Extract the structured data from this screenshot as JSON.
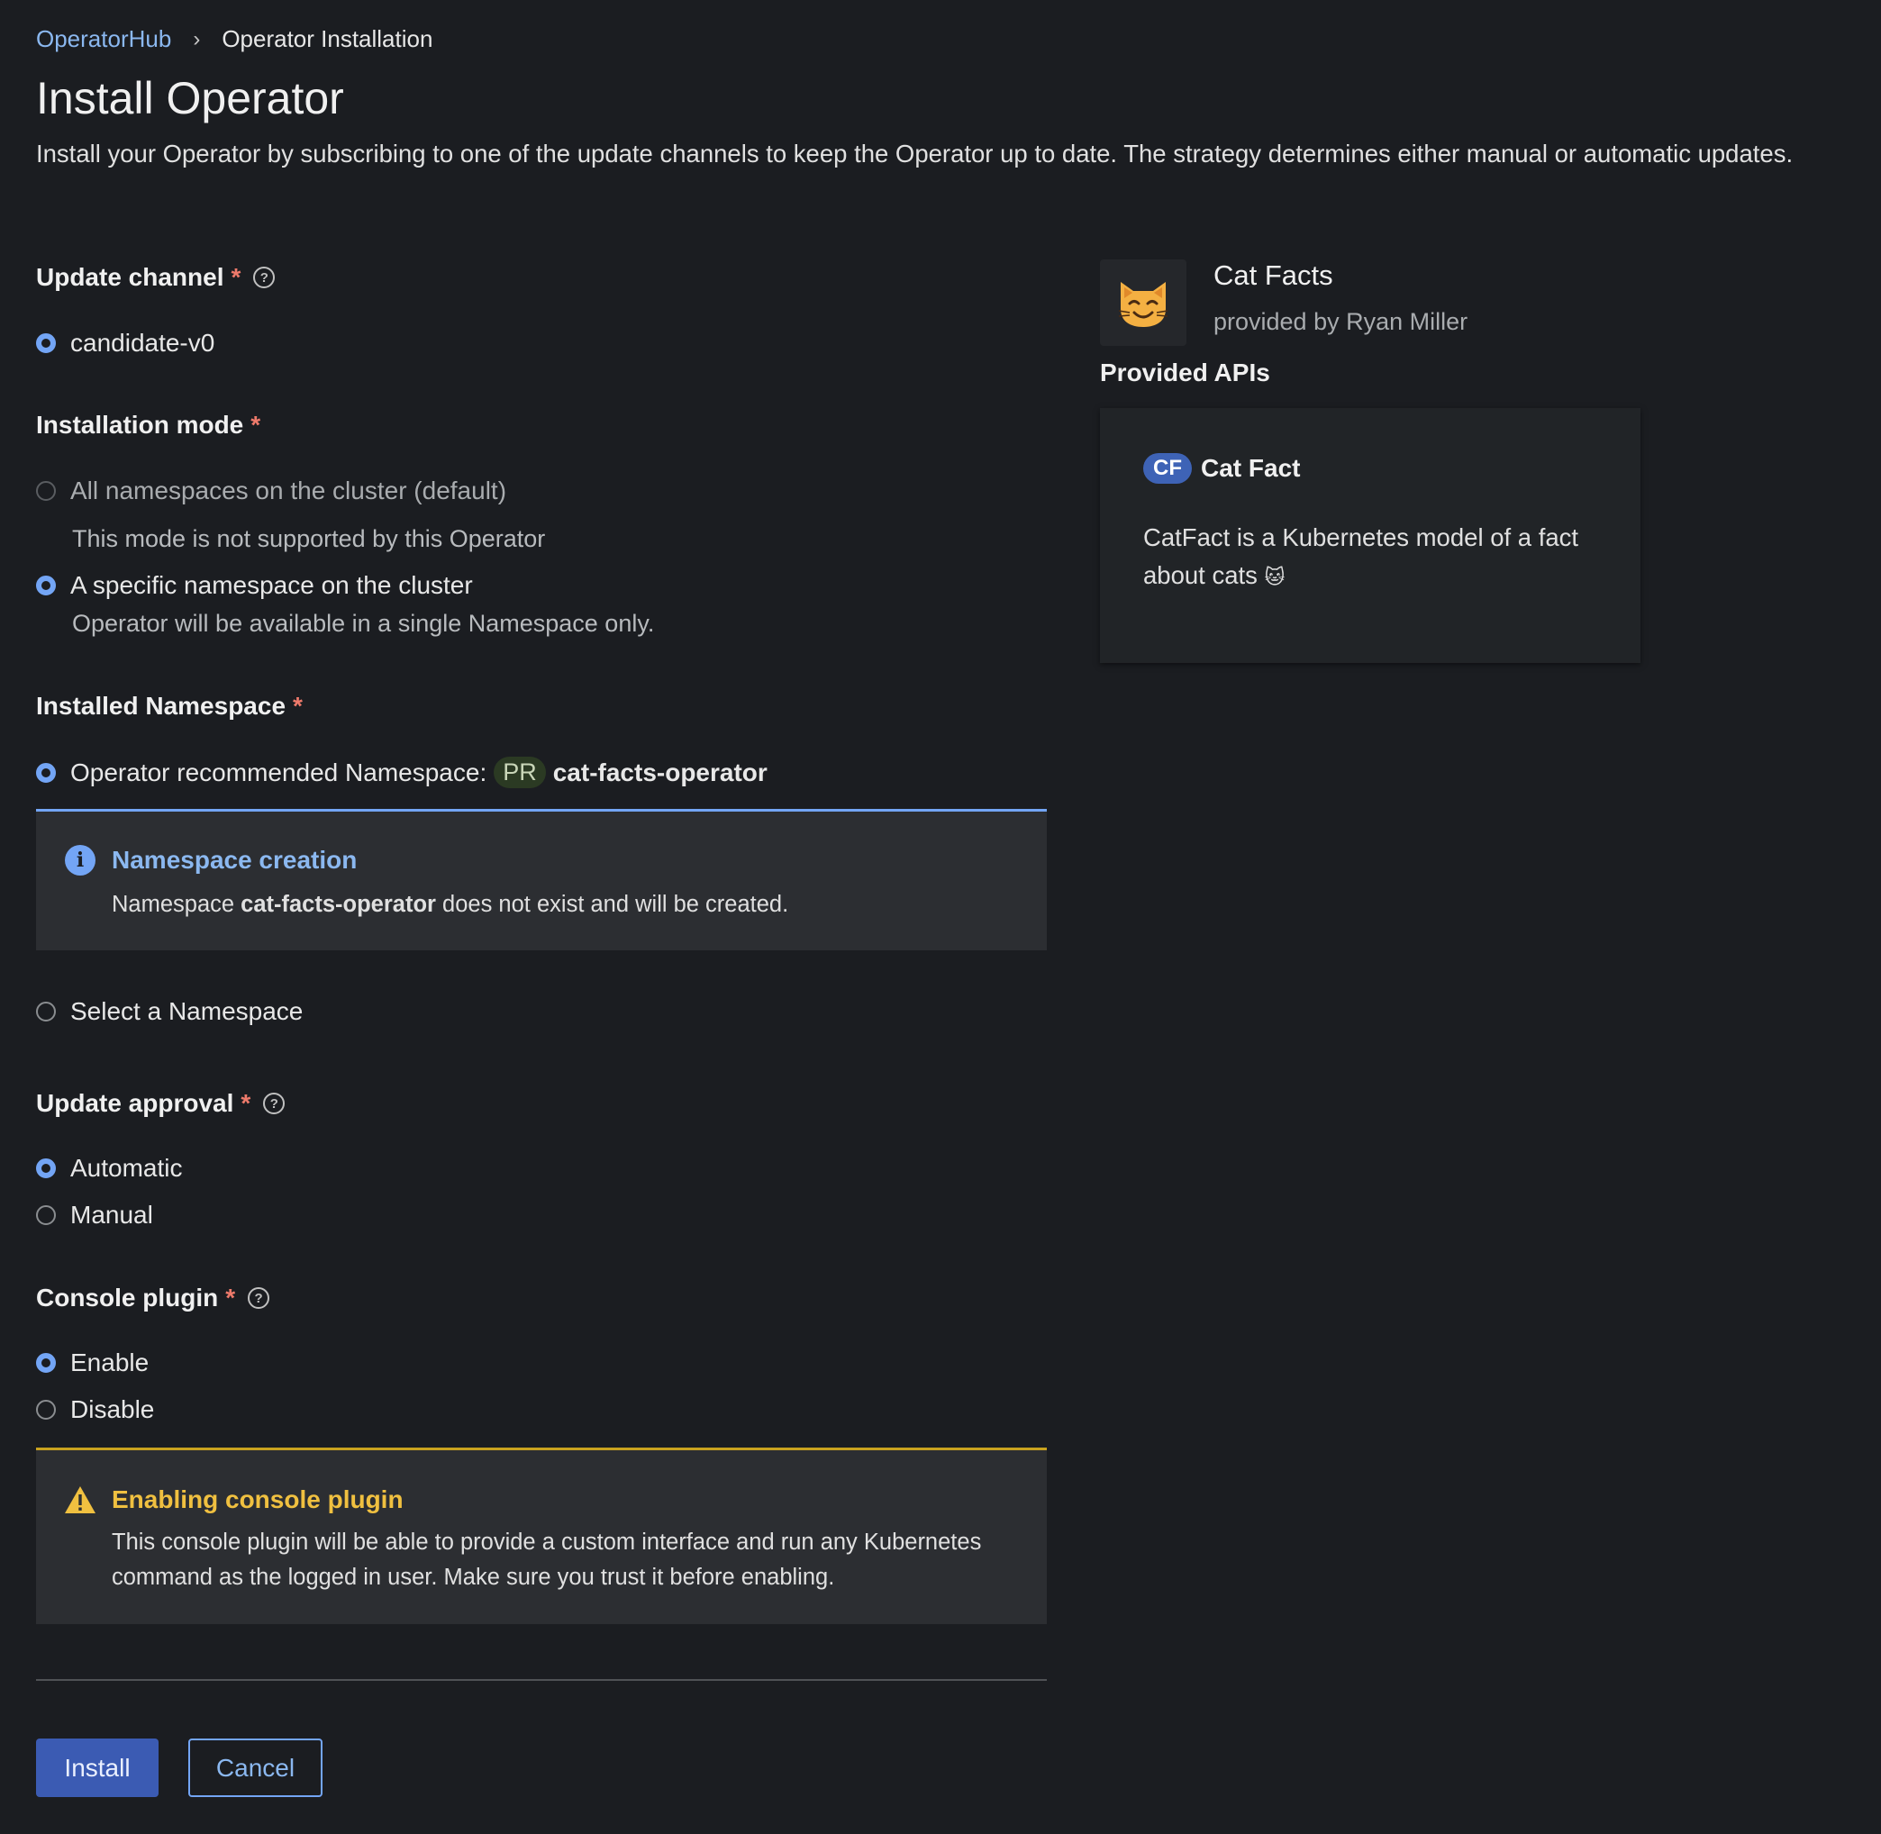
{
  "breadcrumb": {
    "parent": "OperatorHub",
    "current": "Operator Installation"
  },
  "page": {
    "title": "Install Operator",
    "description": "Install your Operator by subscribing to one of the update channels to keep the Operator up to date. The strategy determines either manual or automatic updates."
  },
  "form": {
    "update_channel": {
      "label": "Update channel",
      "required": "*",
      "options": [
        {
          "label": "candidate-v0",
          "selected": true
        }
      ]
    },
    "installation_mode": {
      "label": "Installation mode",
      "required": "*",
      "options": [
        {
          "label": "All namespaces on the cluster (default)",
          "helper": "This mode is not supported by this Operator",
          "selected": false,
          "disabled": true
        },
        {
          "label": "A specific namespace on the cluster",
          "helper": "Operator will be available in a single Namespace only.",
          "selected": true
        }
      ]
    },
    "installed_namespace": {
      "label": "Installed Namespace",
      "required": "*",
      "recommended": {
        "label": "Operator recommended Namespace:",
        "badge": "PR",
        "namespace": "cat-facts-operator",
        "selected": true
      },
      "alert": {
        "title": "Namespace creation",
        "body_prefix": "Namespace ",
        "body_bold": "cat-facts-operator",
        "body_suffix": " does not exist and will be created."
      },
      "select_option": {
        "label": "Select a Namespace",
        "selected": false
      }
    },
    "update_approval": {
      "label": "Update approval",
      "required": "*",
      "options": [
        {
          "label": "Automatic",
          "selected": true
        },
        {
          "label": "Manual",
          "selected": false
        }
      ]
    },
    "console_plugin": {
      "label": "Console plugin",
      "required": "*",
      "options": [
        {
          "label": "Enable",
          "selected": true
        },
        {
          "label": "Disable",
          "selected": false
        }
      ],
      "alert": {
        "title": "Enabling console plugin",
        "body_line1": "This console plugin will be able to provide a custom interface and run any Kubernetes",
        "body_line2": "command as the logged in user. Make sure you trust it before enabling."
      }
    }
  },
  "actions": {
    "install": "Install",
    "cancel": "Cancel"
  },
  "operator": {
    "name": "Cat Facts",
    "provider": "provided by Ryan Miller",
    "icon": "cat-face-emoji",
    "provided_apis_label": "Provided APIs",
    "api": {
      "badge": "CF",
      "name": "Cat Fact",
      "description_line1": "CatFact is a Kubernetes model of a fact",
      "description_line2": "about cats",
      "emoji": "🐱"
    }
  },
  "colors": {
    "background": "#1b1d21",
    "link": "#8bb8f0",
    "required": "#ee7a6b",
    "primary_button": "#3b5bb3",
    "info": "#73a5f5",
    "warning": "#f0c040"
  }
}
